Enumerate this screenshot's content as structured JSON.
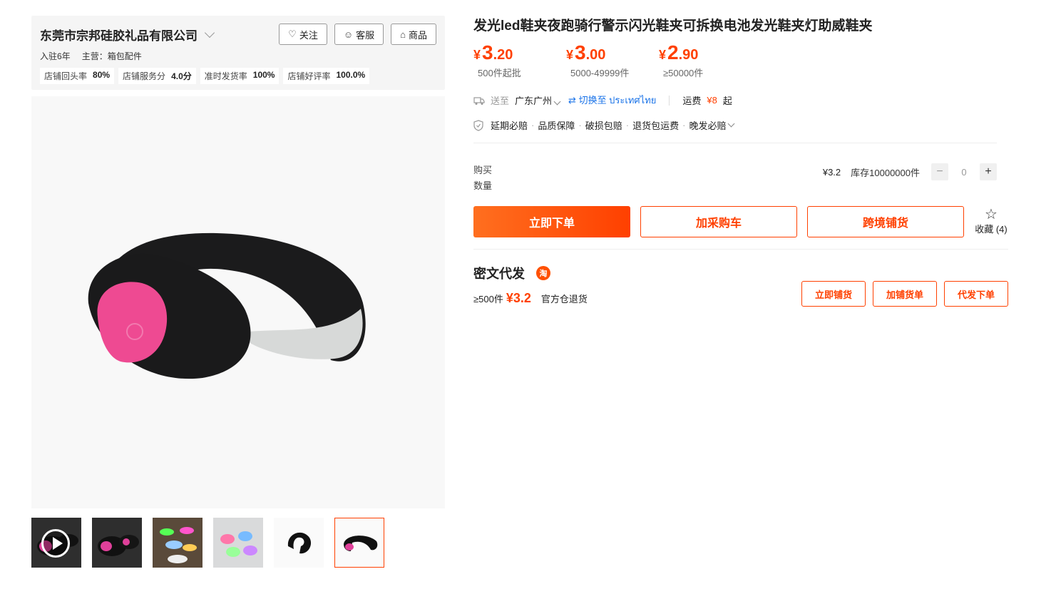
{
  "shop": {
    "name": "东莞市宗邦硅胶礼品有限公司",
    "follow_label": "关注",
    "service_label": "客服",
    "products_label": "商品",
    "years": "入驻6年",
    "main_business": "主营：箱包配件",
    "stats": [
      {
        "label": "店铺回头率",
        "value": "80%"
      },
      {
        "label": "店铺服务分",
        "value": "4.0分"
      },
      {
        "label": "准时发货率",
        "value": "100%"
      },
      {
        "label": "店铺好评率",
        "value": "100.0%"
      }
    ]
  },
  "product": {
    "title": "发光led鞋夹夜跑骑行警示闪光鞋夹可拆换电池发光鞋夹灯助威鞋夹",
    "prices": [
      {
        "currency": "¥",
        "int": "3",
        "dec": ".20",
        "cond": "500件起批"
      },
      {
        "currency": "¥",
        "int": "3",
        "dec": ".00",
        "cond": "5000-49999件"
      },
      {
        "currency": "¥",
        "int": "2",
        "dec": ".90",
        "cond": "≥50000件"
      }
    ]
  },
  "shipping": {
    "send_to_label": "送至",
    "location": "广东广州",
    "switch_label": "切换至 ประเทศไทย",
    "fee_label": "运费",
    "fee_value": "¥8",
    "fee_suffix": "起"
  },
  "guarantees": [
    "延期必赔",
    "品质保障",
    "破损包赔",
    "退货包运费",
    "晚发必赔"
  ],
  "purchase": {
    "qty_label": "购买数量",
    "unit_price": "¥3.2",
    "stock": "库存10000000件",
    "quantity": "0",
    "minus": "−",
    "plus": "+"
  },
  "actions": {
    "order_now": "立即下单",
    "add_cart": "加采购车",
    "cross_border": "跨境铺货",
    "favorite": "收藏 (4)"
  },
  "dropship": {
    "title": "密文代发",
    "badge": "淘",
    "min_qty": "≥500件",
    "price": "¥3.2",
    "note": "官方仓退货",
    "btn_list": "立即铺货",
    "btn_add": "加铺货单",
    "btn_order": "代发下单"
  },
  "colors": {
    "accent": "#ff4000",
    "link": "#1a73e8"
  },
  "icons": {
    "follow": "heart-plus-icon",
    "service": "chat-icon",
    "products": "store-icon",
    "shipping": "truck-icon",
    "switch": "swap-arrows-icon",
    "guarantee": "shield-icon",
    "favorite": "star-icon",
    "play": "play-icon"
  }
}
